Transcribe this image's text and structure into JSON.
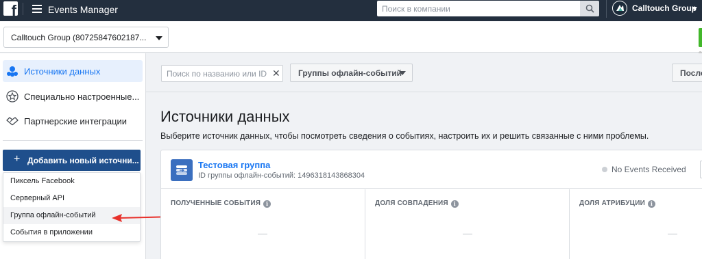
{
  "topbar": {
    "logo": "f",
    "title": "Events Manager",
    "search_placeholder": "Поиск в компании",
    "account_name": "Calltouch Group"
  },
  "subheader": {
    "company_select": "Calltouch Group (80725847602187..."
  },
  "sidebar": {
    "items": [
      {
        "label": "Источники данных",
        "icon": "people-icon",
        "active": true
      },
      {
        "label": "Специально настроенные...",
        "icon": "star-icon",
        "active": false
      },
      {
        "label": "Партнерские интеграции",
        "icon": "handshake-icon",
        "active": false
      }
    ],
    "add_button": "Добавить новый источни...",
    "dropdown": [
      "Пиксель Facebook",
      "Серверный API",
      "Группа офлайн-событий",
      "События в приложении"
    ]
  },
  "filters": {
    "search_placeholder": "Поиск по названию или ID",
    "group_filter": "Группы офлайн-событий",
    "last_button": "Последние"
  },
  "main": {
    "title": "Источники данных",
    "subtitle": "Выберите источник данных, чтобы посмотреть сведения о событиях, настроить их и решить связанные с ними проблемы."
  },
  "card": {
    "name": "Тестовая группа",
    "id_text": "ID группы офлайн-событий: 1496318143868304",
    "status": "No Events Received",
    "metrics": [
      {
        "label": "ПОЛУЧЕННЫЕ СОБЫТИЯ",
        "value": "—"
      },
      {
        "label": "ДОЛЯ СОВПАДЕНИЯ",
        "value": "—"
      },
      {
        "label": "ДОЛЯ АТРИБУЦИИ",
        "value": "—"
      }
    ]
  },
  "colors": {
    "topbar": "#232f3e",
    "accent": "#1876f2",
    "primary_button": "#1f4f8c",
    "annotation_arrow": "#e8312b"
  }
}
